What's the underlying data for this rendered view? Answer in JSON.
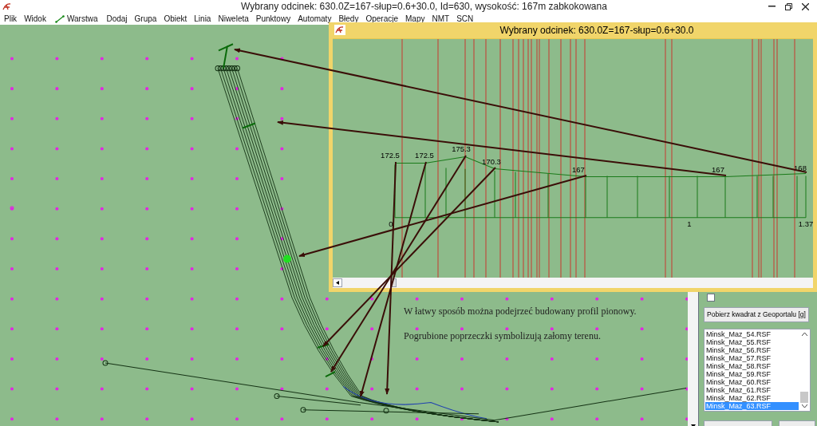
{
  "window": {
    "title": "Wybrany odcinek: 630.0Z=167-słup=0.6+30.0, Id=630, wysokość: 167m zabkokowana"
  },
  "menu": [
    {
      "label": "Plik",
      "kind": "plain"
    },
    {
      "label": "Widok",
      "kind": "plain"
    },
    {
      "label": "Warstwa",
      "kind": "icon"
    },
    {
      "label": "Dodaj",
      "kind": "plain"
    },
    {
      "label": "Grupa",
      "kind": "plain"
    },
    {
      "label": "Obiekt",
      "kind": "plain"
    },
    {
      "label": "Linia",
      "kind": "plain"
    },
    {
      "label": "Niweleta",
      "kind": "plain"
    },
    {
      "label": "Punktowy",
      "kind": "plain"
    },
    {
      "label": "Automaty",
      "kind": "plain"
    },
    {
      "label": "Błedy",
      "kind": "plain"
    },
    {
      "label": "Operacje",
      "kind": "plain"
    },
    {
      "label": "Mapy",
      "kind": "plain"
    },
    {
      "label": "NMT",
      "kind": "plain"
    },
    {
      "label": "SCN",
      "kind": "plain"
    }
  ],
  "profile_window": {
    "title": "Wybrany odcinek: 630.0Z=167-słup=0.6+30.0",
    "elevation_labels": [
      "172.5",
      "172.5",
      "175.3",
      "170.3",
      "167",
      "167",
      "168"
    ],
    "distance_labels": [
      "0",
      "1",
      "1.37"
    ]
  },
  "annotations": [
    "W łatwy sposób można podejrzeć budowany profil pionowy.",
    "Pogrubione poprzeczki symbolizują załomy terenu."
  ],
  "side_panel": {
    "checkbox": {
      "checked": false
    },
    "button": "Pobierz kwadrat z Geoportalu [g]",
    "files": [
      {
        "name": "Minsk_Maz_54.RSF",
        "selected": false
      },
      {
        "name": "Minsk_Maz_55.RSF",
        "selected": false
      },
      {
        "name": "Minsk_Maz_56.RSF",
        "selected": false
      },
      {
        "name": "Minsk_Maz_57.RSF",
        "selected": false
      },
      {
        "name": "Minsk_Maz_58.RSF",
        "selected": false
      },
      {
        "name": "Minsk_Maz_59.RSF",
        "selected": false
      },
      {
        "name": "Minsk_Maz_60.RSF",
        "selected": false
      },
      {
        "name": "Minsk_Maz_61.RSF",
        "selected": false
      },
      {
        "name": "Minsk_Maz_62.RSF",
        "selected": false
      },
      {
        "name": "Minsk_Maz_63.RSF",
        "selected": true
      }
    ]
  }
}
